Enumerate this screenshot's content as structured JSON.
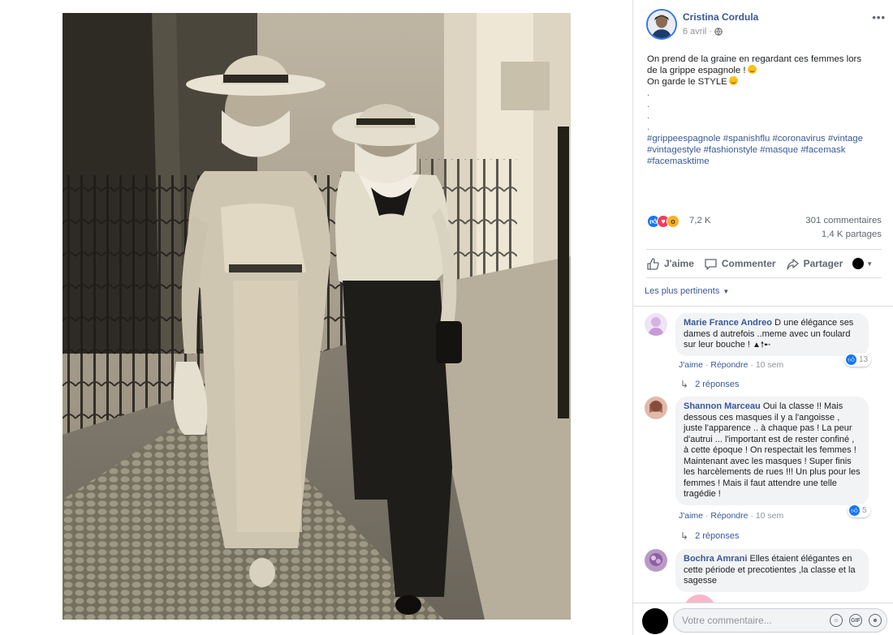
{
  "post": {
    "author": "Cristina Cordula",
    "date": "6 avril",
    "text_lines": [
      "On prend de la graine en regardant ces femmes lors",
      "de la grippe espagnole !",
      "On garde le STYLE"
    ],
    "dots": [
      ".",
      ".",
      ".",
      "."
    ],
    "hashtag_lines": [
      "#grippeespagnole #spanishflu #coronavirus #vintage",
      "#vintagestyle #fashionstyle #masque #facemask",
      "#facemasktime"
    ]
  },
  "stats": {
    "reactions": "7,2 K",
    "comments": "301 commentaires",
    "shares": "1,4 K partages"
  },
  "actions": {
    "like": "J'aime",
    "comment": "Commenter",
    "share": "Partager"
  },
  "sort_label": "Les plus pertinents",
  "comments": [
    {
      "name": "Marie France Andreo",
      "text": "D une élégance ses dames d autrefois ..meme avec un foulard sur leur bouche !",
      "like": "J'aime",
      "reply": "Répondre",
      "time": "10 sem",
      "likes": "13",
      "replies": "2 réponses",
      "avatar_color": "#e8d7f2"
    },
    {
      "name": "Shannon Marceau",
      "text": "Oui la classe !! Mais dessous ces masques il y a l'angoisse , juste l'apparence .. à chaque pas ! La peur d'autrui ... l'important est de rester confiné , à cette époque ! On respectait les femmes ! Maintenant avec les masques ! Super finis les harcèlements de rues !!! Un plus pour les femmes ! Mais il faut attendre une telle tragédie !",
      "like": "J'aime",
      "reply": "Répondre",
      "time": "10 sem",
      "likes": "5",
      "replies": "2 réponses",
      "avatar_color": "#c98a7a"
    },
    {
      "name": "Bochra Amrani",
      "text": "Elles étaient élégantes en cette période et precotientes ,la classe et la sagesse",
      "avatar_color": "#7d5a8c"
    }
  ],
  "composer": {
    "placeholder": "Votre commentaire..."
  },
  "colors": {
    "link": "#385898",
    "like_blue": "#1877f2",
    "love_red": "#f33e58",
    "wow_yellow": "#f7b125"
  }
}
